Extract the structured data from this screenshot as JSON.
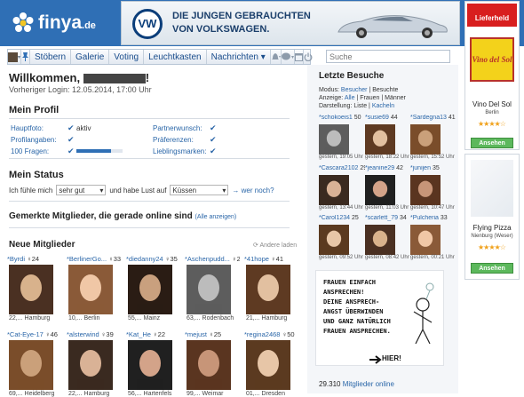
{
  "header": {
    "logo_text": "finya",
    "logo_tld": ".de",
    "ad": {
      "brand": "VW",
      "line1": "DIE JUNGEN GEBRAUCHTEN",
      "line2": "VON VOLKSWAGEN."
    }
  },
  "nav": {
    "items": [
      "Stöbern",
      "Galerie",
      "Voting",
      "Leuchtkasten",
      "Nachrichten ▾"
    ],
    "search_placeholder": "Suche"
  },
  "welcome": {
    "title": "Willkommen,",
    "suffix": "!",
    "last_login": "Vorheriger Login: 12.05.2014, 17:00 Uhr"
  },
  "profile": {
    "title": "Mein Profil",
    "left": [
      {
        "label": "Hauptfoto:",
        "value": "aktiv"
      },
      {
        "label": "Profilangaben:",
        "value": ""
      },
      {
        "label": "100 Fragen:",
        "value": ""
      }
    ],
    "right": [
      {
        "label": "Partnerwunsch:"
      },
      {
        "label": "Präferenzen:"
      },
      {
        "label": "Lieblingsmarken:"
      }
    ],
    "fragen_progress": 0.75
  },
  "status": {
    "title": "Mein Status",
    "pre": "Ich fühle mich",
    "mood": "sehr gut",
    "mid": "und habe Lust auf",
    "wish": "Küssen",
    "link": "→ wer noch?"
  },
  "gemerkt": {
    "title": "Gemerkte Mitglieder, die gerade online sind",
    "link": "(Alle anzeigen)"
  },
  "neue": {
    "title": "Neue Mitglieder",
    "andere": "Andere laden",
    "members": [
      {
        "name": "Byrdi",
        "age": "24",
        "cap": "22,... Hamburg"
      },
      {
        "name": "BerlinerGo...",
        "age": "33",
        "cap": "10,... Berlin"
      },
      {
        "name": "diedanny24",
        "age": "35",
        "cap": "55,... Mainz"
      },
      {
        "name": "Aschenpudd...",
        "age": "28",
        "cap": "63,... Rodenbach"
      },
      {
        "name": "41hope",
        "age": "41",
        "cap": "21,... Hamburg"
      },
      {
        "name": "Cat-Eye-17",
        "age": "46",
        "cap": "69,... Heidelberg"
      },
      {
        "name": "alsterwind",
        "age": "39",
        "cap": "22,... Hamburg"
      },
      {
        "name": "Kat_He",
        "age": "22",
        "cap": "56,... Hartenfels"
      },
      {
        "name": "mejust",
        "age": "25",
        "cap": "99,... Weimar"
      },
      {
        "name": "regina2468",
        "age": "50",
        "cap": "01,... Dresden"
      }
    ]
  },
  "visits": {
    "title": "Letzte Besuche",
    "modus_label": "Modus:",
    "modus_a": "Besucher",
    "modus_b": "Besuchte",
    "anzeige_label": "Anzeige:",
    "anzeige": [
      "Alle",
      "Frauen",
      "Männer"
    ],
    "darst_label": "Darstellung:",
    "darst": [
      "Liste",
      "Kacheln"
    ],
    "items": [
      {
        "name": "schokoeis1",
        "age": "50",
        "cap": "gestern, 19:05 Uhr"
      },
      {
        "name": "susie69",
        "age": "44",
        "cap": "gestern, 18:22 Uhr"
      },
      {
        "name": "Sardegna13",
        "age": "41",
        "cap": "gestern, 15:52 Uhr"
      },
      {
        "name": "Cascara2102",
        "age": "29",
        "cap": "gestern, 13:44 Uhr"
      },
      {
        "name": "jeanine29",
        "age": "42",
        "cap": "gestern, 11:03 Uhr"
      },
      {
        "name": "junijen",
        "age": "35",
        "cap": "gestern, 10:47 Uhr"
      },
      {
        "name": "Carol1234",
        "age": "25",
        "cap": "gestern, 09:52 Uhr"
      },
      {
        "name": "scarlett_79",
        "age": "34",
        "cap": "gestern, 08:42 Uhr"
      },
      {
        "name": "Pulcheria",
        "age": "33",
        "cap": "gestern, 00:21 Uhr"
      }
    ]
  },
  "sketch": {
    "text": "FRAUEN EINFACH\nANSPRECHEN!\nDEINE ANSPRECH-\nANGST ÜBERWINDEN\nUND GANZ NATÜRLICH\nFRAUEN ANSPRECHEN.",
    "hier": "HIER!"
  },
  "online": {
    "count": "29.310",
    "label": "Mitglieder online"
  },
  "ads": {
    "lieferheld": "Lieferheld",
    "vino_logo": "Vino del Sol",
    "vino_name": "Vino Del Sol",
    "vino_city": "Berlin",
    "vino_btn": "Ansehen",
    "pizza_name": "Flying Pizza",
    "pizza_city": "Nienburg (Weser)",
    "pizza_btn": "Ansehen"
  },
  "colors": {
    "brand": "#2f6fb5",
    "link": "#2a66a8",
    "button": "#5cb85c"
  }
}
